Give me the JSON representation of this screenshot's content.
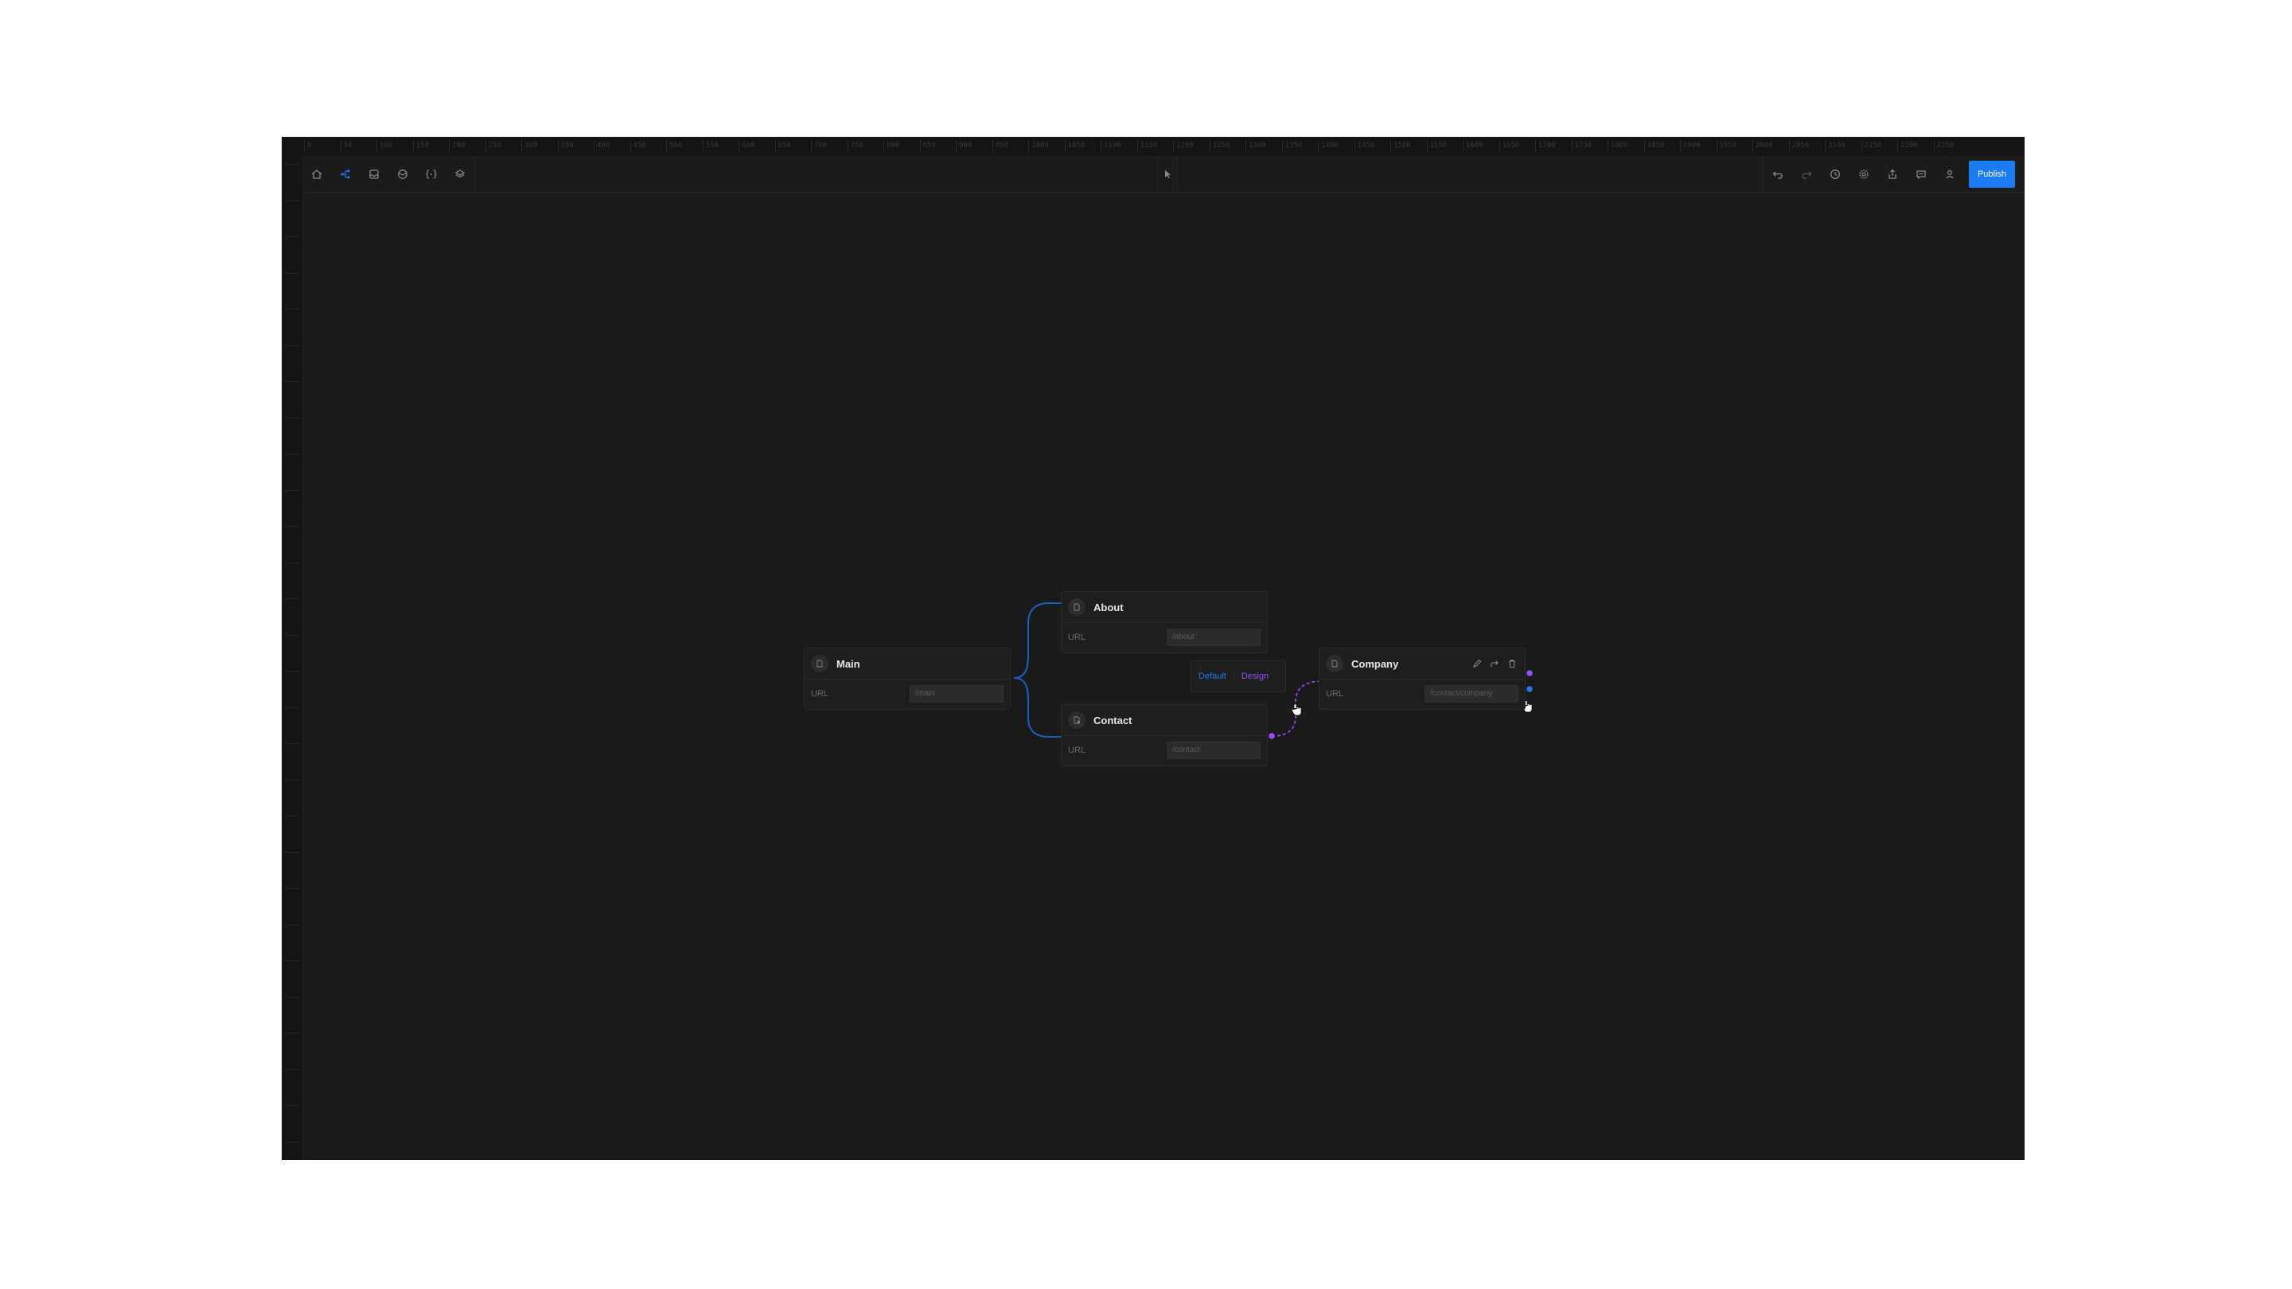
{
  "ruler": {
    "top_ticks": [
      "0",
      "50",
      "100",
      "150",
      "200",
      "250",
      "300",
      "350",
      "400",
      "450",
      "500",
      "550",
      "600",
      "650",
      "700",
      "750",
      "800",
      "850",
      "900",
      "950",
      "1000",
      "1050",
      "1100",
      "1150",
      "1200",
      "1250",
      "1300",
      "1350",
      "1400",
      "1450",
      "1500",
      "1550",
      "1600",
      "1650",
      "1700",
      "1750",
      "1800",
      "1850",
      "1900",
      "1950",
      "2000",
      "2050",
      "2100",
      "2150",
      "2200",
      "2250"
    ]
  },
  "toolbar": {
    "left_icons": [
      "home-icon",
      "sitemap-icon",
      "inbox-icon",
      "package-icon",
      "variables-icon",
      "layers-icon"
    ],
    "center_icon": "cursor-icon",
    "right_icons": [
      "undo-icon",
      "redo-icon",
      "history-icon",
      "settings-icon",
      "share-icon",
      "comment-icon",
      "user-icon"
    ],
    "publish_label": "Publish",
    "active_color": "#1a7bf2"
  },
  "nodes": {
    "main": {
      "title": "Main",
      "url_label": "URL",
      "url_value": "/main",
      "icon": "page-icon"
    },
    "about": {
      "title": "About",
      "url_label": "URL",
      "url_value": "/about",
      "icon": "page-icon"
    },
    "contact": {
      "title": "Contact",
      "url_label": "URL",
      "url_value": "/contact",
      "icon": "page-branch-icon"
    },
    "company": {
      "title": "Company",
      "url_label": "URL",
      "url_value": "/contact/company",
      "icon": "page-icon",
      "actions": [
        "edit-icon",
        "redirect-icon",
        "trash-icon"
      ]
    }
  },
  "variant_switch": {
    "default_label": "Default",
    "design_label": "Design",
    "default_color": "#1a7bf2",
    "design_color": "#9b4dff"
  },
  "colors": {
    "canvas": "#1a1a1a",
    "link_blue": "#1a5fc4",
    "link_purple": "#9b4dff"
  }
}
